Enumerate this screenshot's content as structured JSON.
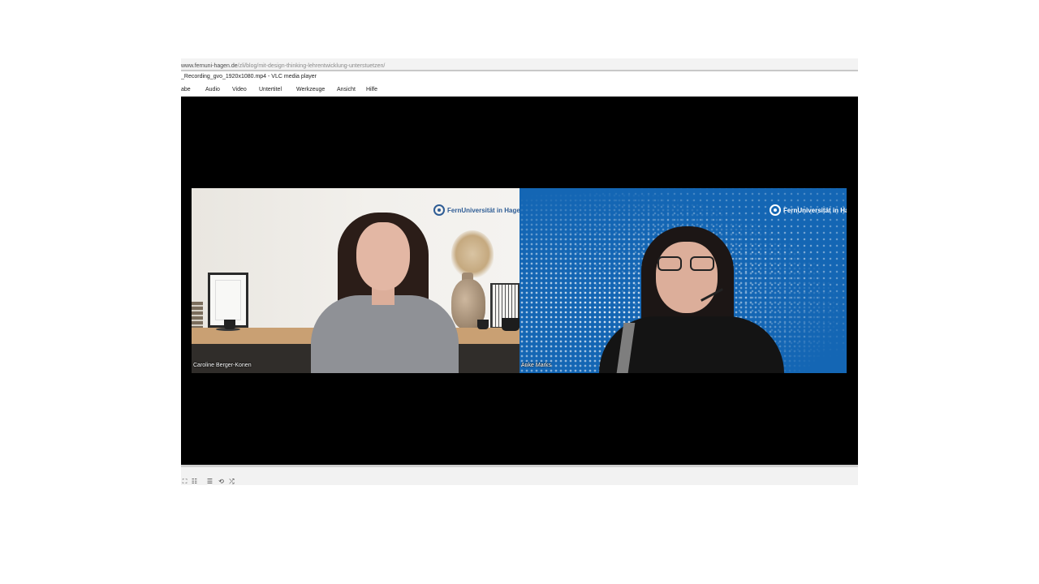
{
  "browser": {
    "url_domain": "www.fernuni-hagen.de",
    "url_path": "/zli/blog/mit-design-thinking-lehrentwicklung-unterstuetzen/"
  },
  "window": {
    "title": "_Recording_gvo_1920x1080.mp4 - VLC media player"
  },
  "menu": {
    "items": [
      "abe",
      "Audio",
      "Video",
      "Untertitel",
      "Werkzeuge",
      "Ansicht",
      "Hilfe"
    ]
  },
  "video": {
    "participants": [
      {
        "name": "Caroline Berger-Konen"
      },
      {
        "name": "Anke Marks"
      }
    ],
    "logo_text": "FernUniversität in Hagen"
  },
  "controls": {
    "icons": [
      "fullscreen-icon",
      "extended-settings-icon",
      "playlist-icon",
      "loop-icon",
      "shuffle-icon"
    ],
    "glyphs": [
      "⛶",
      "☷",
      "☰",
      "⟲",
      "⤮"
    ]
  },
  "colors": {
    "video_bg": "#000000",
    "right_panel_blue": "#1466b4",
    "logo_blue": "#2f5d95"
  }
}
